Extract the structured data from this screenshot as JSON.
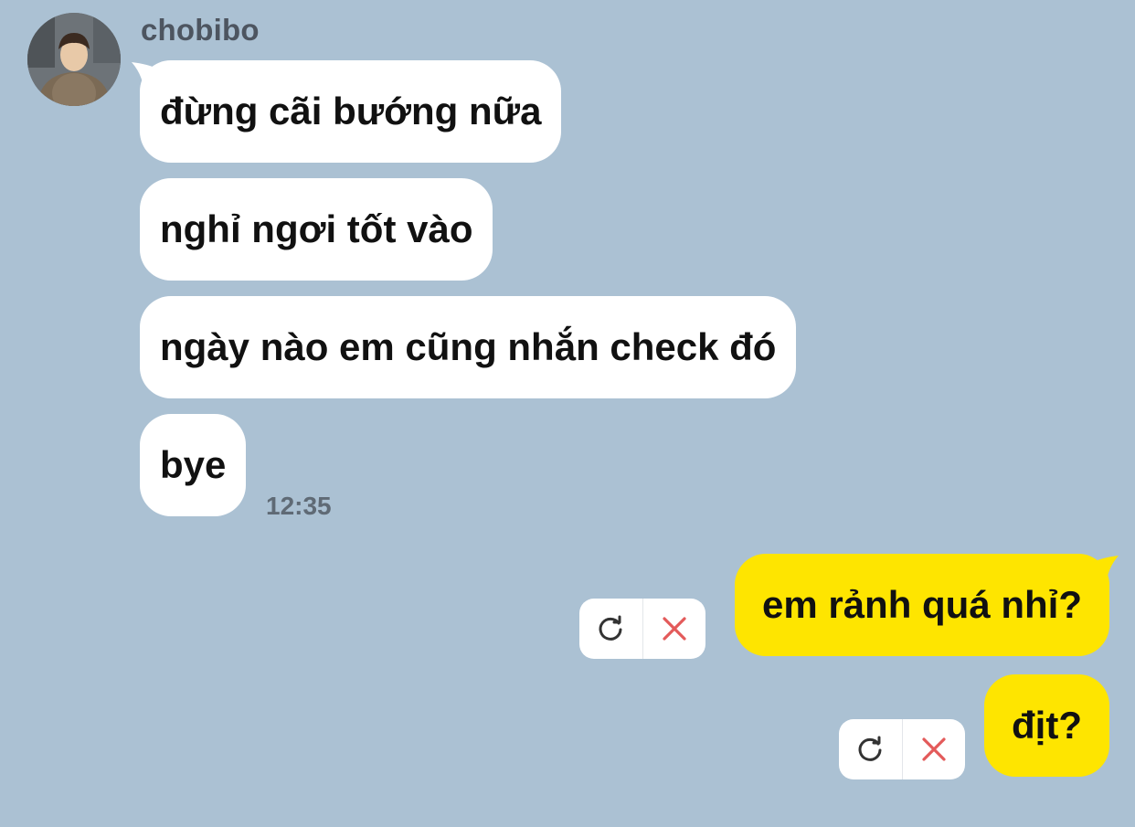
{
  "sender": {
    "name": "chobibo"
  },
  "incoming_messages": [
    "đừng cãi bướng nữa",
    "nghỉ ngơi tốt vào",
    "ngày nào em cũng nhắn check đó",
    "bye"
  ],
  "incoming_time": "12:35",
  "outgoing_messages": [
    "em rảnh quá nhỉ?",
    "địt?"
  ],
  "colors": {
    "background": "#abc1d3",
    "incoming_bubble": "#ffffff",
    "outgoing_bubble": "#fee500",
    "cancel_icon": "#e35a5a"
  },
  "icons": {
    "retry": "retry-icon",
    "cancel": "cancel-icon"
  }
}
